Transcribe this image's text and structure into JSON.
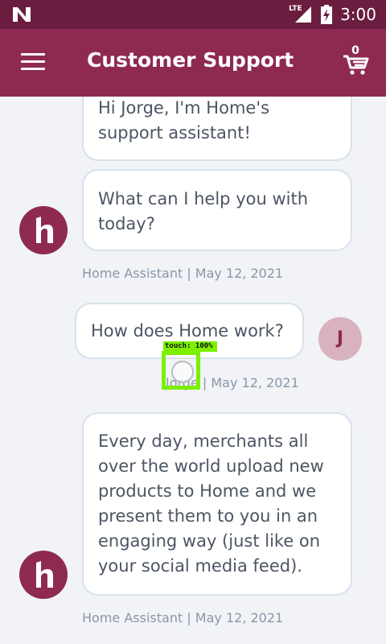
{
  "status_bar": {
    "network": "LTE",
    "time": "3:00"
  },
  "app_bar": {
    "title": "Customer Support",
    "cart_count": "0"
  },
  "messages": [
    {
      "sender": "assistant",
      "text": "Hi Jorge, I'm Home's support assistant!"
    },
    {
      "sender": "assistant",
      "text": "What can I help you with today?"
    },
    {
      "sender": "user",
      "text": "How does Home work?"
    },
    {
      "sender": "assistant",
      "text": "Every day, merchants all over the world upload new products to Home and we present them to you in an engaging way (just like on your social media feed)."
    }
  ],
  "meta": {
    "assistant_1": "Home Assistant | May 12, 2021",
    "user_1": "Jorge | May 12, 2021",
    "assistant_2": "Home Assistant | May 12, 2021"
  },
  "avatars": {
    "user_initial": "J"
  },
  "touch_indicator": {
    "label": "touch: 100%"
  },
  "colors": {
    "status_bar": "#6a1d3e",
    "app_bar": "#8e2a52",
    "background": "#f1f3f6",
    "user_avatar": "#d8b2bf"
  }
}
